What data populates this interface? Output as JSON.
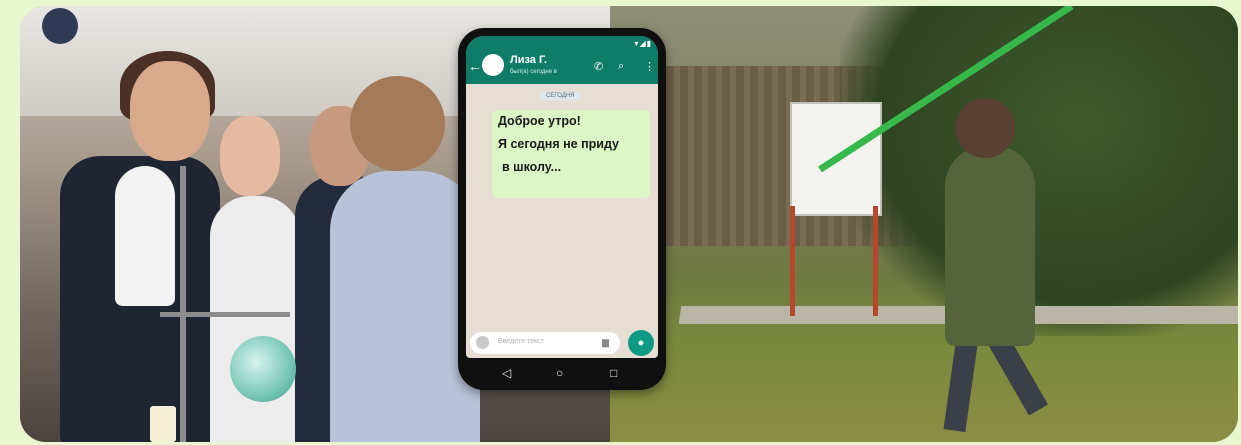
{
  "chat": {
    "contact_name": "Лиза Г.",
    "contact_status": "был(а) сегодня в",
    "date_label": "СЕГОДНЯ",
    "message_lines": [
      "Доброе утро!",
      "Я сегодня не приду",
      "в школу..."
    ],
    "input_placeholder": "Введите текст"
  },
  "icons": {
    "back": "back-arrow-icon",
    "call": "phone-icon",
    "attach": "attach-icon",
    "menu": "kebab-menu-icon",
    "mic": "microphone-icon",
    "emoji": "emoji-icon",
    "nav": [
      "nav-back-icon",
      "nav-home-icon",
      "nav-recents-icon"
    ]
  },
  "colors": {
    "background": "#e8f7cf",
    "chat_header": "#0f7c6a",
    "bubble": "#dbf7c5",
    "mic_button": "#0f9a85"
  }
}
